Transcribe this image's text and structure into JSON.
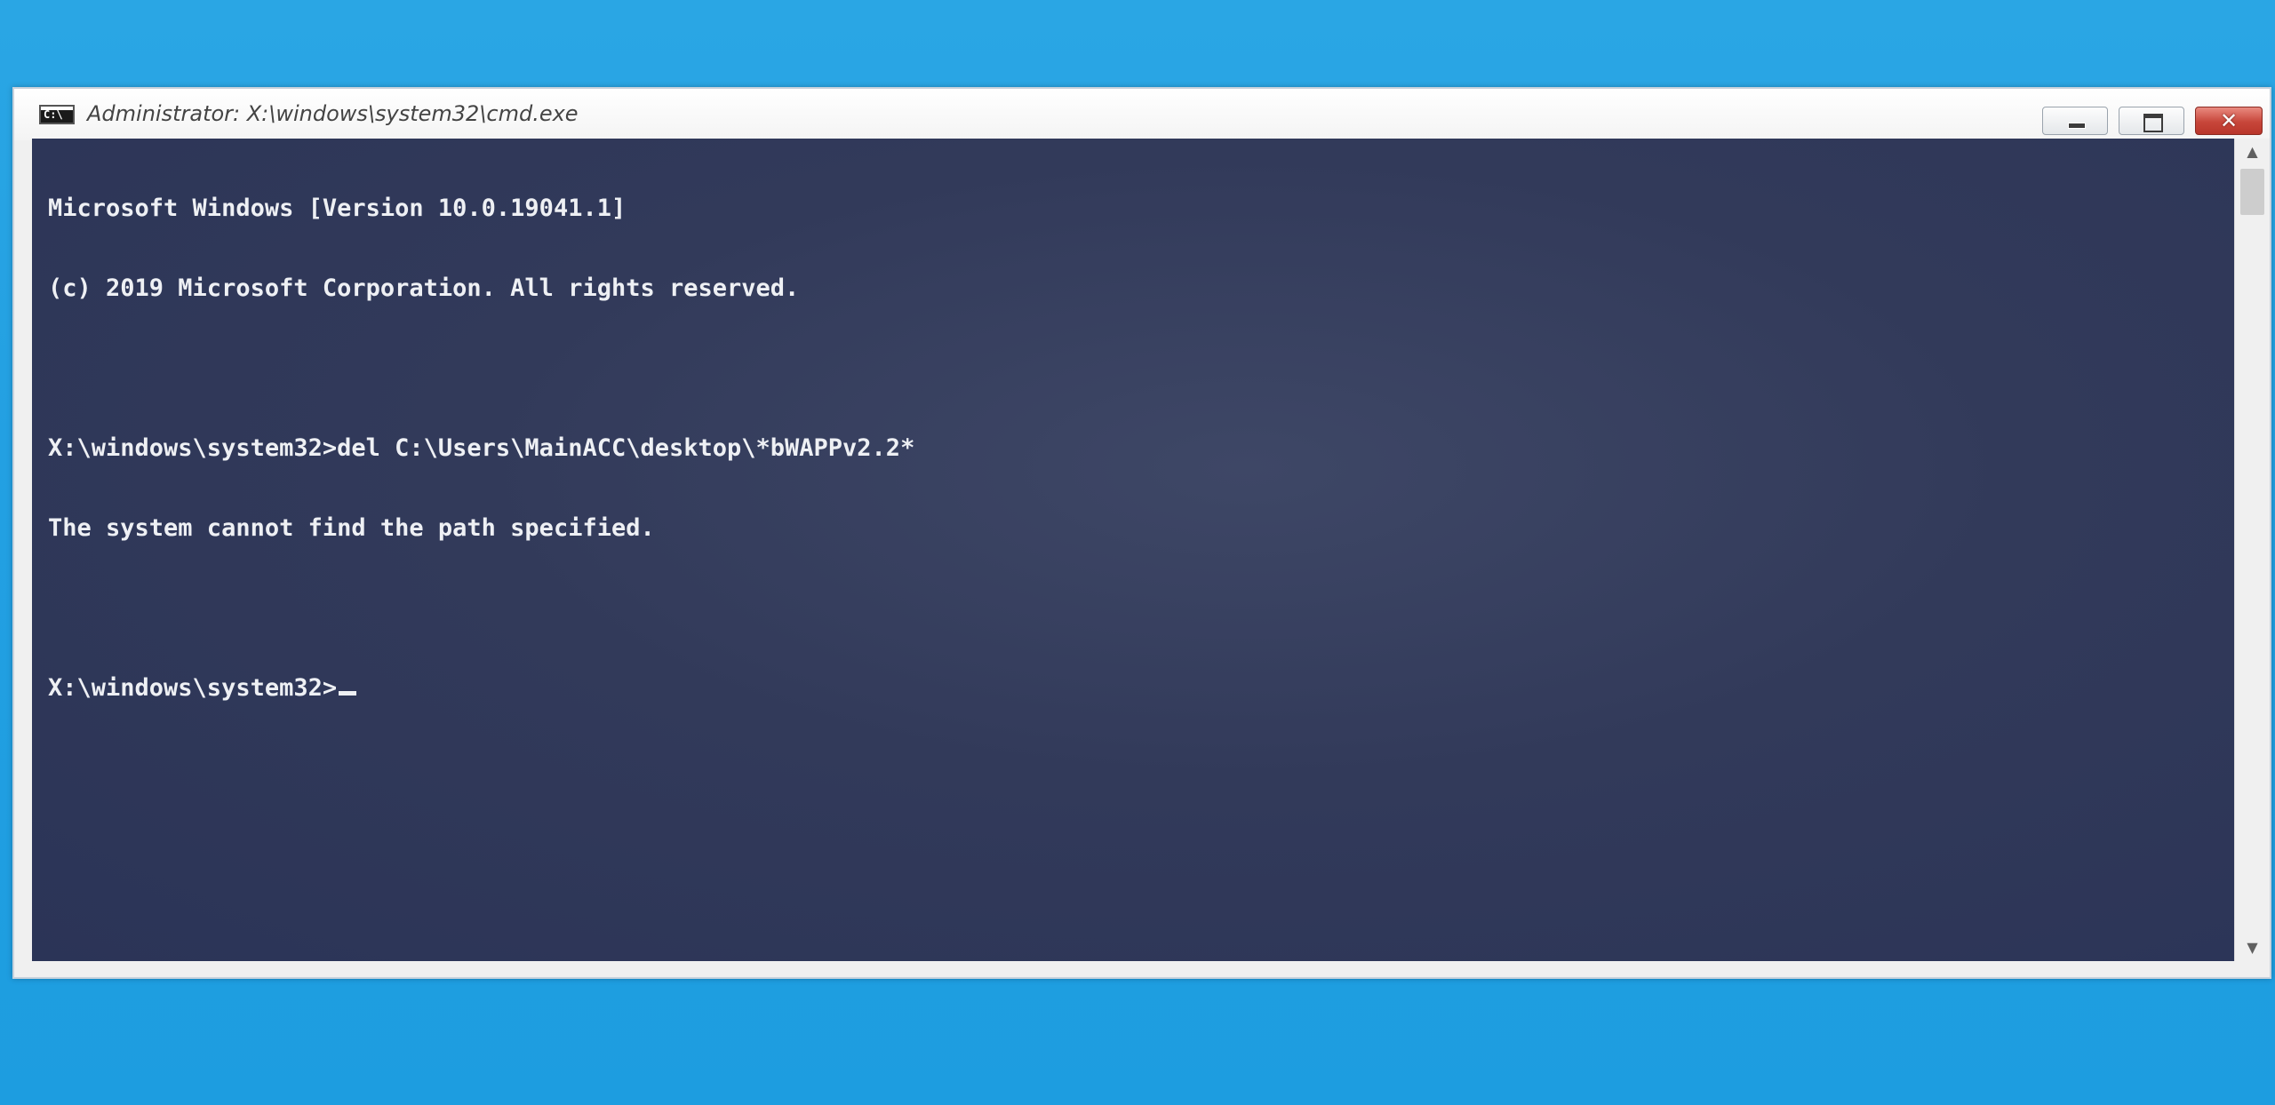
{
  "window": {
    "title": "Administrator: X:\\windows\\system32\\cmd.exe",
    "icon": "cmd-icon",
    "icon_text": "C:\\",
    "controls": {
      "minimize": "minimize-icon",
      "maximize": "maximize-icon",
      "close": "close-icon",
      "close_glyph": "✕"
    }
  },
  "console": {
    "lines": [
      "Microsoft Windows [Version 10.0.19041.1]",
      "(c) 2019 Microsoft Corporation. All rights reserved.",
      "",
      "X:\\windows\\system32>del C:\\Users\\MainACC\\desktop\\*bWAPPv2.2*",
      "The system cannot find the path specified.",
      "",
      "X:\\windows\\system32>"
    ],
    "text_color": "#eef0f4",
    "background_color": "#333b5c"
  },
  "scrollbar": {
    "up_glyph": "▲",
    "down_glyph": "▼"
  },
  "colors": {
    "desktop": "#23a0e2",
    "close_button": "#c7463a"
  }
}
